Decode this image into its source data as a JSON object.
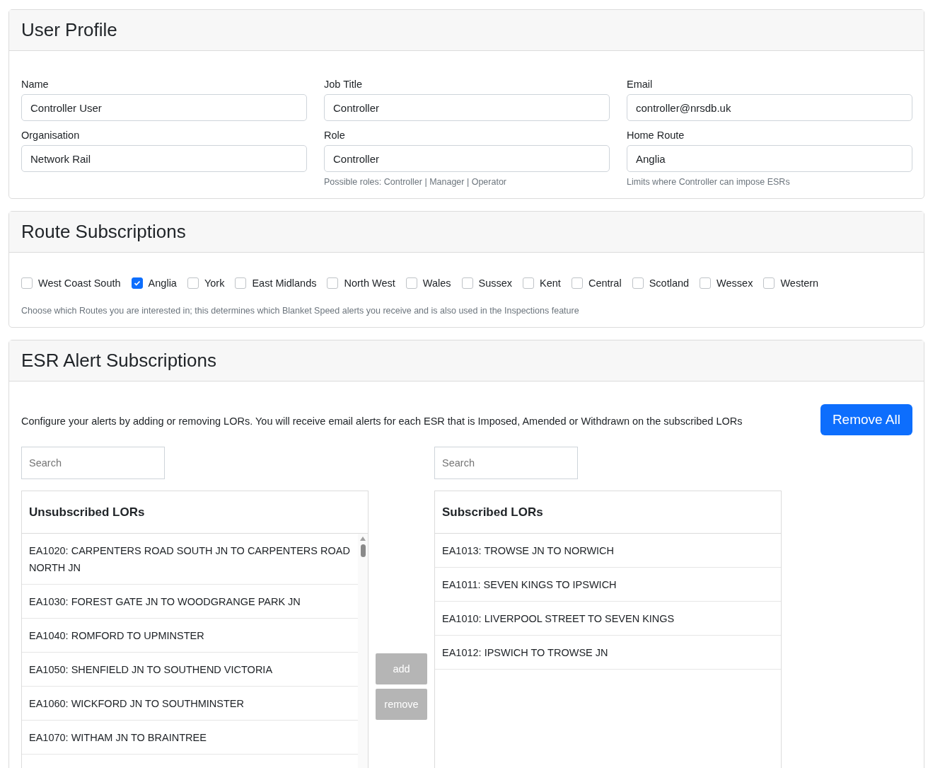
{
  "profile": {
    "title": "User Profile",
    "fields": [
      {
        "label": "Name",
        "value": "Controller User"
      },
      {
        "label": "Job Title",
        "value": "Controller"
      },
      {
        "label": "Email",
        "value": "controller@nrsdb.uk"
      },
      {
        "label": "Organisation",
        "value": "Network Rail"
      },
      {
        "label": "Role",
        "value": "Controller",
        "help": "Possible roles: Controller | Manager | Operator"
      },
      {
        "label": "Home Route",
        "value": "Anglia",
        "help": "Limits where Controller can impose ESRs"
      }
    ]
  },
  "routes": {
    "title": "Route Subscriptions",
    "items": [
      {
        "label": "West Coast South",
        "checked": false
      },
      {
        "label": "Anglia",
        "checked": true
      },
      {
        "label": "York",
        "checked": false
      },
      {
        "label": "East Midlands",
        "checked": false
      },
      {
        "label": "North West",
        "checked": false
      },
      {
        "label": "Wales",
        "checked": false
      },
      {
        "label": "Sussex",
        "checked": false
      },
      {
        "label": "Kent",
        "checked": false
      },
      {
        "label": "Central",
        "checked": false
      },
      {
        "label": "Scotland",
        "checked": false
      },
      {
        "label": "Wessex",
        "checked": false
      },
      {
        "label": "Western",
        "checked": false
      }
    ],
    "help": "Choose which Routes you are interested in; this determines which Blanket Speed alerts you receive and is also used in the Inspections feature"
  },
  "alerts": {
    "title": "ESR Alert Subscriptions",
    "intro": "Configure your alerts by adding or removing LORs. You will receive email alerts for each ESR that is Imposed, Amended or Withdrawn on the subscribed LORs",
    "remove_all": "Remove All",
    "unsubscribed": {
      "search_placeholder": "Search",
      "heading": "Unsubscribed LORs",
      "items": [
        "EA1020: CARPENTERS ROAD SOUTH JN TO CARPENTERS ROAD NORTH JN",
        "EA1030: FOREST GATE JN TO WOODGRANGE PARK JN",
        "EA1040: ROMFORD TO UPMINSTER",
        "EA1050: SHENFIELD JN TO SOUTHEND VICTORIA",
        "EA1060: WICKFORD JN TO SOUTHMINSTER",
        "EA1070: WITHAM JN TO BRAINTREE"
      ]
    },
    "buttons": [
      {
        "label": "add",
        "disabled": true
      },
      {
        "label": "remove",
        "disabled": true
      }
    ],
    "subscribed": {
      "search_placeholder": "Search",
      "heading": "Subscribed LORs",
      "items": [
        "EA1013: TROWSE JN TO NORWICH",
        "EA1011: SEVEN KINGS TO IPSWICH",
        "EA1010: LIVERPOOL STREET TO SEVEN KINGS",
        "EA1012: IPSWICH TO TROWSE JN"
      ]
    }
  }
}
